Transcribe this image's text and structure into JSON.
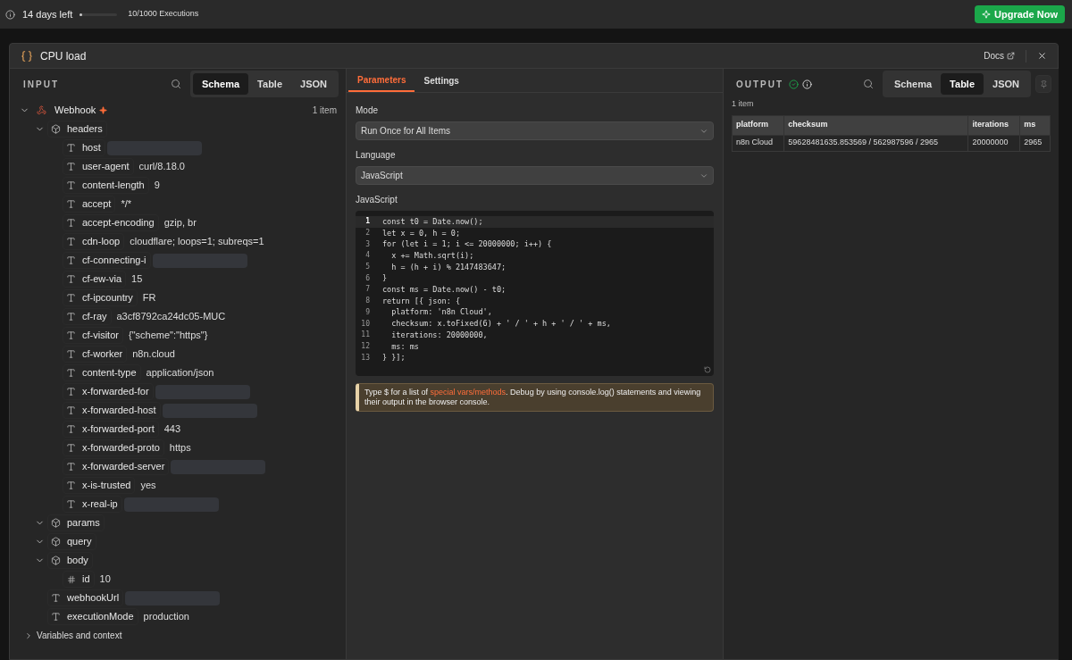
{
  "trial": {
    "days_left": "14 days left",
    "level": 0.01,
    "executions": "10/1000 Executions",
    "upgrade": "Upgrade Now"
  },
  "modal": {
    "title": "CPU load",
    "docs": "Docs"
  },
  "input": {
    "title": "INPUT",
    "views": [
      {
        "label": "Schema",
        "selected": true
      },
      {
        "label": "Table",
        "selected": false
      },
      {
        "label": "JSON",
        "selected": false
      }
    ],
    "node": {
      "name": "Webhook",
      "count": "1 item",
      "expanded": true
    },
    "tree": [
      {
        "key": "headers",
        "kind": "object",
        "expanded": true,
        "children": [
          {
            "key": "host",
            "kind": "string",
            "redacted": true
          },
          {
            "key": "user-agent",
            "kind": "string",
            "value": "curl/8.18.0",
            "redacted": false
          },
          {
            "key": "content-length",
            "kind": "string",
            "value": "9",
            "redacted": false
          },
          {
            "key": "accept",
            "kind": "string",
            "value": "*/*",
            "redacted": false
          },
          {
            "key": "accept-encoding",
            "kind": "string",
            "value": "gzip, br",
            "redacted": false
          },
          {
            "key": "cdn-loop",
            "kind": "string",
            "value": "cloudflare; loops=1; subreqs=1",
            "redacted": false
          },
          {
            "key": "cf-connecting-i",
            "kind": "string",
            "redacted": true
          },
          {
            "key": "cf-ew-via",
            "kind": "string",
            "value": "15",
            "redacted": false
          },
          {
            "key": "cf-ipcountry",
            "kind": "string",
            "value": "FR",
            "redacted": false
          },
          {
            "key": "cf-ray",
            "kind": "string",
            "value": "a3cf8792ca24dc05-MUC",
            "redacted": false
          },
          {
            "key": "cf-visitor",
            "kind": "string",
            "value": "{\"scheme\":\"https\"}",
            "redacted": false
          },
          {
            "key": "cf-worker",
            "kind": "string",
            "value": "n8n.cloud",
            "redacted": false
          },
          {
            "key": "content-type",
            "kind": "string",
            "value": "application/json",
            "redacted": false
          },
          {
            "key": "x-forwarded-for",
            "kind": "string",
            "redacted": true
          },
          {
            "key": "x-forwarded-host",
            "kind": "string",
            "redacted": true
          },
          {
            "key": "x-forwarded-port",
            "kind": "string",
            "value": "443",
            "redacted": false
          },
          {
            "key": "x-forwarded-proto",
            "kind": "string",
            "value": "https",
            "redacted": false
          },
          {
            "key": "x-forwarded-server",
            "kind": "string",
            "redacted": true
          },
          {
            "key": "x-is-trusted",
            "kind": "string",
            "value": "yes",
            "redacted": false
          },
          {
            "key": "x-real-ip",
            "kind": "string",
            "redacted": true
          }
        ]
      },
      {
        "key": "params",
        "kind": "object",
        "expanded": true
      },
      {
        "key": "query",
        "kind": "object",
        "expanded": true
      },
      {
        "key": "body",
        "kind": "object",
        "expanded": true,
        "children": [
          {
            "key": "id",
            "kind": "number",
            "value": "10",
            "redacted": false
          }
        ]
      },
      {
        "key": "webhookUrl",
        "kind": "string",
        "redacted": true
      },
      {
        "key": "executionMode",
        "kind": "string",
        "value": "production",
        "redacted": false
      }
    ],
    "context": {
      "label": "Variables and context",
      "expanded": false
    }
  },
  "params": {
    "tabs": [
      {
        "label": "Parameters",
        "selected": true
      },
      {
        "label": "Settings",
        "selected": false
      }
    ],
    "fields": [
      {
        "label": "Mode",
        "value": "Run Once for All Items"
      },
      {
        "label": "Language",
        "value": "JavaScript"
      }
    ],
    "code_label": "JavaScript",
    "code": [
      {
        "number": "1",
        "text": "const t0 = Date.now();",
        "active": true
      },
      {
        "number": "2",
        "text": "let x = 0, h = 0;",
        "active": false
      },
      {
        "number": "3",
        "text": "for (let i = 1; i <= 20000000; i++) {",
        "active": false
      },
      {
        "number": "4",
        "text": "  x += Math.sqrt(i);",
        "active": false
      },
      {
        "number": "5",
        "text": "  h = (h + i) % 2147483647;",
        "active": false
      },
      {
        "number": "6",
        "text": "}",
        "active": false
      },
      {
        "number": "7",
        "text": "const ms = Date.now() - t0;",
        "active": false
      },
      {
        "number": "8",
        "text": "return [{ json: {",
        "active": false
      },
      {
        "number": "9",
        "text": "  platform: 'n8n Cloud',",
        "active": false
      },
      {
        "number": "10",
        "text": "  checksum: x.toFixed(6) + ' / ' + h + ' / ' + ms,",
        "active": false
      },
      {
        "number": "11",
        "text": "  iterations: 20000000,",
        "active": false
      },
      {
        "number": "12",
        "text": "  ms: ms",
        "active": false
      },
      {
        "number": "13",
        "text": "} }];",
        "active": false
      }
    ],
    "hint": {
      "before": "Type $ for a list of",
      "link": "special vars/methods",
      "after": ". Debug by using console.log() statements and viewing their output in the browser console."
    }
  },
  "output": {
    "title": "OUTPUT",
    "success": true,
    "views": [
      {
        "label": "Schema",
        "selected": false
      },
      {
        "label": "Table",
        "selected": true
      },
      {
        "label": "JSON",
        "selected": false
      }
    ],
    "count": "1 item",
    "table": {
      "columns": [
        "platform",
        "checksum",
        "iterations",
        "ms"
      ],
      "rows": [
        [
          "n8n Cloud",
          "59628481635.853569 / 562987596 / 2965",
          "20000000",
          "2965"
        ]
      ]
    }
  }
}
